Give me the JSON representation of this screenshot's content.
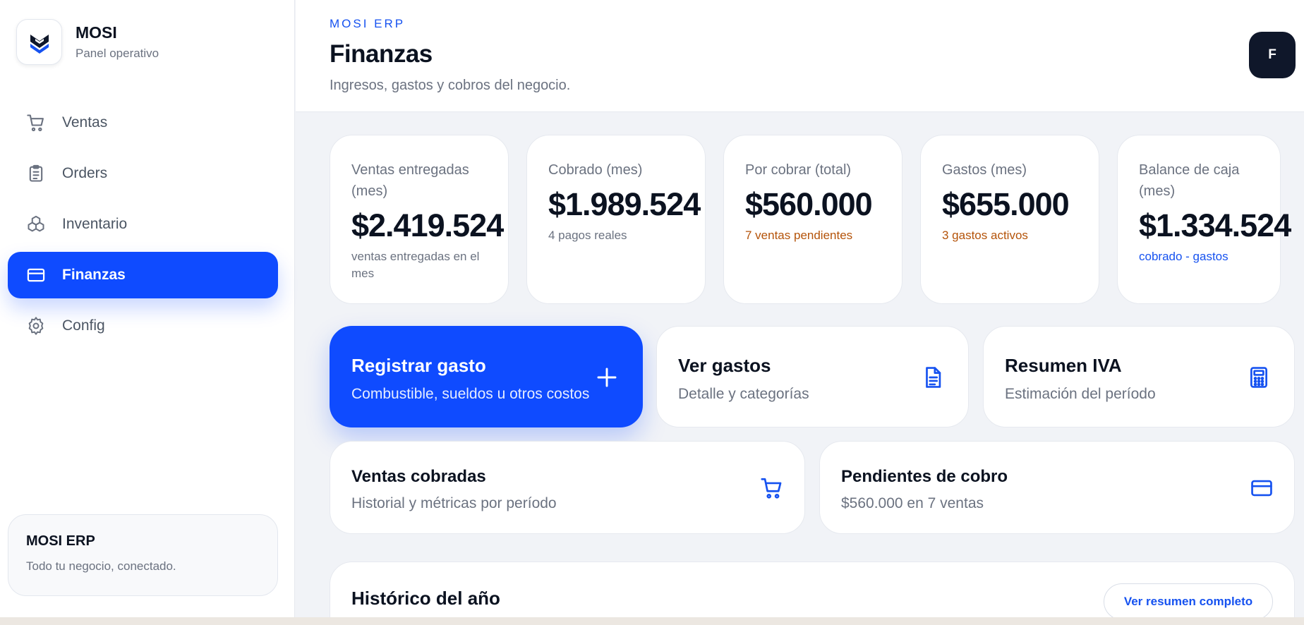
{
  "brand": {
    "name": "MOSI",
    "subtitle": "Panel operativo"
  },
  "nav": [
    {
      "label": "Ventas",
      "icon": "cart-icon",
      "active": false
    },
    {
      "label": "Orders",
      "icon": "clipboard-icon",
      "active": false
    },
    {
      "label": "Inventario",
      "icon": "boxes-icon",
      "active": false
    },
    {
      "label": "Finanzas",
      "icon": "credit-card-icon",
      "active": true
    },
    {
      "label": "Config",
      "icon": "gear-icon",
      "active": false
    }
  ],
  "sidebar_footer": {
    "title": "MOSI ERP",
    "subtitle": "Todo tu negocio, conectado."
  },
  "header": {
    "eyebrow": "MOSI ERP",
    "title": "Finanzas",
    "subtitle": "Ingresos, gastos y cobros del negocio.",
    "avatar_initial": "F"
  },
  "stats": [
    {
      "label": "Ventas entregadas (mes)",
      "value": "$2.419.524",
      "note": "ventas entregadas en el mes",
      "tone": "muted"
    },
    {
      "label": "Cobrado (mes)",
      "value": "$1.989.524",
      "note": "4 pagos reales",
      "tone": "muted"
    },
    {
      "label": "Por cobrar (total)",
      "value": "$560.000",
      "note": "7 ventas pendientes",
      "tone": "warn"
    },
    {
      "label": "Gastos (mes)",
      "value": "$655.000",
      "note": "3 gastos activos",
      "tone": "warn"
    },
    {
      "label": "Balance de caja (mes)",
      "value": "$1.334.524",
      "note": "cobrado - gastos",
      "tone": "info"
    }
  ],
  "actions": [
    {
      "title": "Registrar gasto",
      "subtitle": "Combustible, sueldos u otros costos",
      "icon": "plus-icon"
    },
    {
      "title": "Ver gastos",
      "subtitle": "Detalle y categorías",
      "icon": "document-icon"
    },
    {
      "title": "Resumen IVA",
      "subtitle": "Estimación del período",
      "icon": "calculator-icon"
    },
    {
      "title": "Ventas cobradas",
      "subtitle": "Historial y métricas por período",
      "icon": "cart-icon"
    },
    {
      "title": "Pendientes de cobro",
      "subtitle": "$560.000 en 7 ventas",
      "icon": "credit-card-icon"
    }
  ],
  "history": {
    "title": "Histórico del año",
    "button_label": "Ver resumen completo"
  },
  "colors": {
    "accent": "#0f4bff",
    "warn": "#b45309",
    "text": "#0b1220",
    "muted": "#6b7280"
  }
}
